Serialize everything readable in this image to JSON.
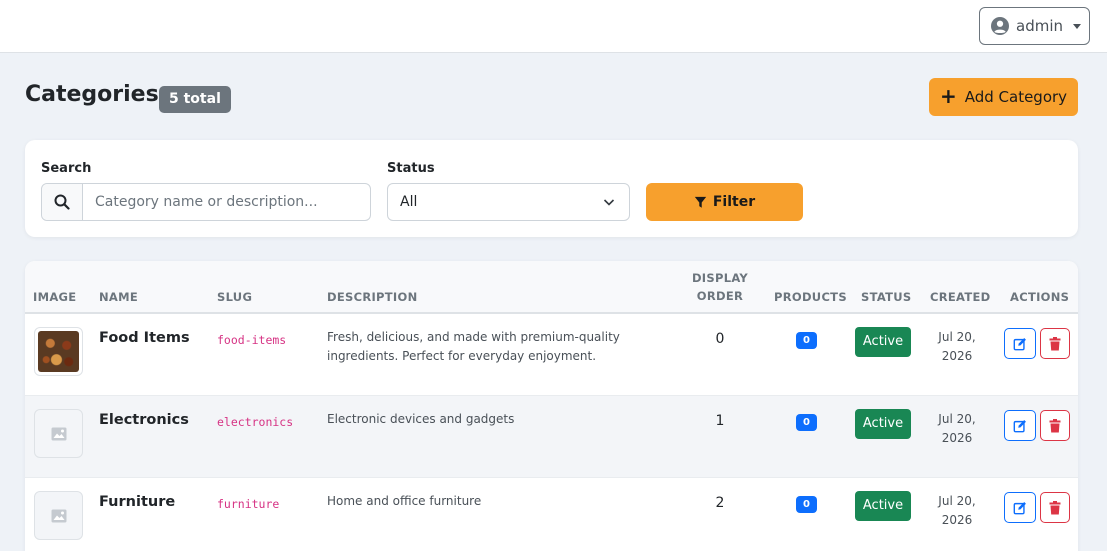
{
  "topbar": {
    "user_label": "admin"
  },
  "header": {
    "title": "Categories",
    "total_badge": "5 total",
    "add_button_label": "Add Category"
  },
  "filters": {
    "search_label": "Search",
    "search_placeholder": "Category name or description...",
    "search_value": "",
    "status_label": "Status",
    "status_value": "All",
    "filter_button_label": "Filter"
  },
  "table": {
    "columns": {
      "image": "IMAGE",
      "name": "NAME",
      "slug": "SLUG",
      "description": "DESCRIPTION",
      "display_order_line1": "DISPLAY",
      "display_order_line2": "ORDER",
      "products": "PRODUCTS",
      "status": "STATUS",
      "created": "CREATED",
      "actions": "ACTIONS"
    },
    "rows": [
      {
        "has_image": true,
        "name": "Food Items",
        "slug": "food-items",
        "desc_line1": "Fresh, delicious, and made with premium-quality",
        "desc_line2": "ingredients. Perfect for everyday enjoyment.",
        "display_order": "0",
        "products": "0",
        "status": "Active",
        "created_line1": "Jul 20,",
        "created_line2": "2026"
      },
      {
        "has_image": false,
        "name": "Electronics",
        "slug": "electronics",
        "desc_line1": "Electronic devices and gadgets",
        "desc_line2": "",
        "display_order": "1",
        "products": "0",
        "status": "Active",
        "created_line1": "Jul 20,",
        "created_line2": "2026"
      },
      {
        "has_image": false,
        "name": "Furniture",
        "slug": "furniture",
        "desc_line1": "Home and office furniture",
        "desc_line2": "",
        "display_order": "2",
        "products": "0",
        "status": "Active",
        "created_line1": "Jul 20,",
        "created_line2": "2026"
      }
    ]
  },
  "icons": {
    "user": "user-circle-icon",
    "plus": "plus-icon",
    "search": "search-icon",
    "chevron": "chevron-down-icon",
    "filter": "filter-icon",
    "edit": "edit-icon",
    "delete": "trash-icon",
    "image_placeholder": "image-icon"
  },
  "colors": {
    "accent": "#f7a02d",
    "primary": "#0d6efd",
    "success": "#198754",
    "danger": "#dc3545",
    "muted_badge": "#6c757d",
    "slug": "#d63384"
  }
}
